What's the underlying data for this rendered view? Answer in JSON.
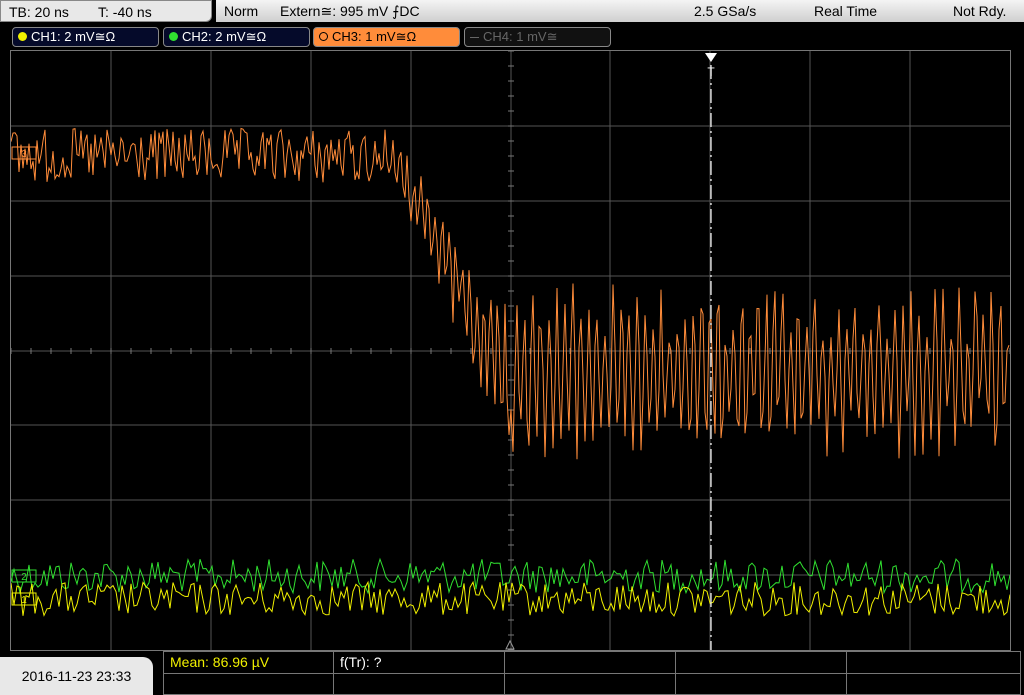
{
  "timebase": {
    "tb": "TB: 20 ns",
    "trigger_offset": "T: -40 ns"
  },
  "status": {
    "mode": "Norm",
    "trigger": "Extern≅: 995 mV ⨍DC",
    "sample_rate": "2.5 GSa/s",
    "acq_mode": "Real Time",
    "state": "Not Rdy."
  },
  "channels": [
    {
      "label": "CH1: 2 mV≅Ω",
      "color": "#f0f000",
      "active": true
    },
    {
      "label": "CH2: 2 mV≅Ω",
      "color": "#30e030",
      "active": true
    },
    {
      "label": "CH3: 1 mV≅Ω",
      "color": "#ff8c3a",
      "active": true,
      "selected": true
    },
    {
      "label": "CH4: 1 mV≅",
      "color": "#777777",
      "active": false
    }
  ],
  "markers": {
    "trigger_marker": "T",
    "ch_labels": [
      "3",
      "2",
      "1"
    ]
  },
  "datetime": "2016-11-23 23:33",
  "measurements": {
    "mean": "Mean: 86.96 µV",
    "ftr": "f(Tr): ?"
  },
  "colors": {
    "ch1": "#f0f000",
    "ch2": "#30e030",
    "ch3": "#ff8c3a",
    "grid": "#555555"
  }
}
